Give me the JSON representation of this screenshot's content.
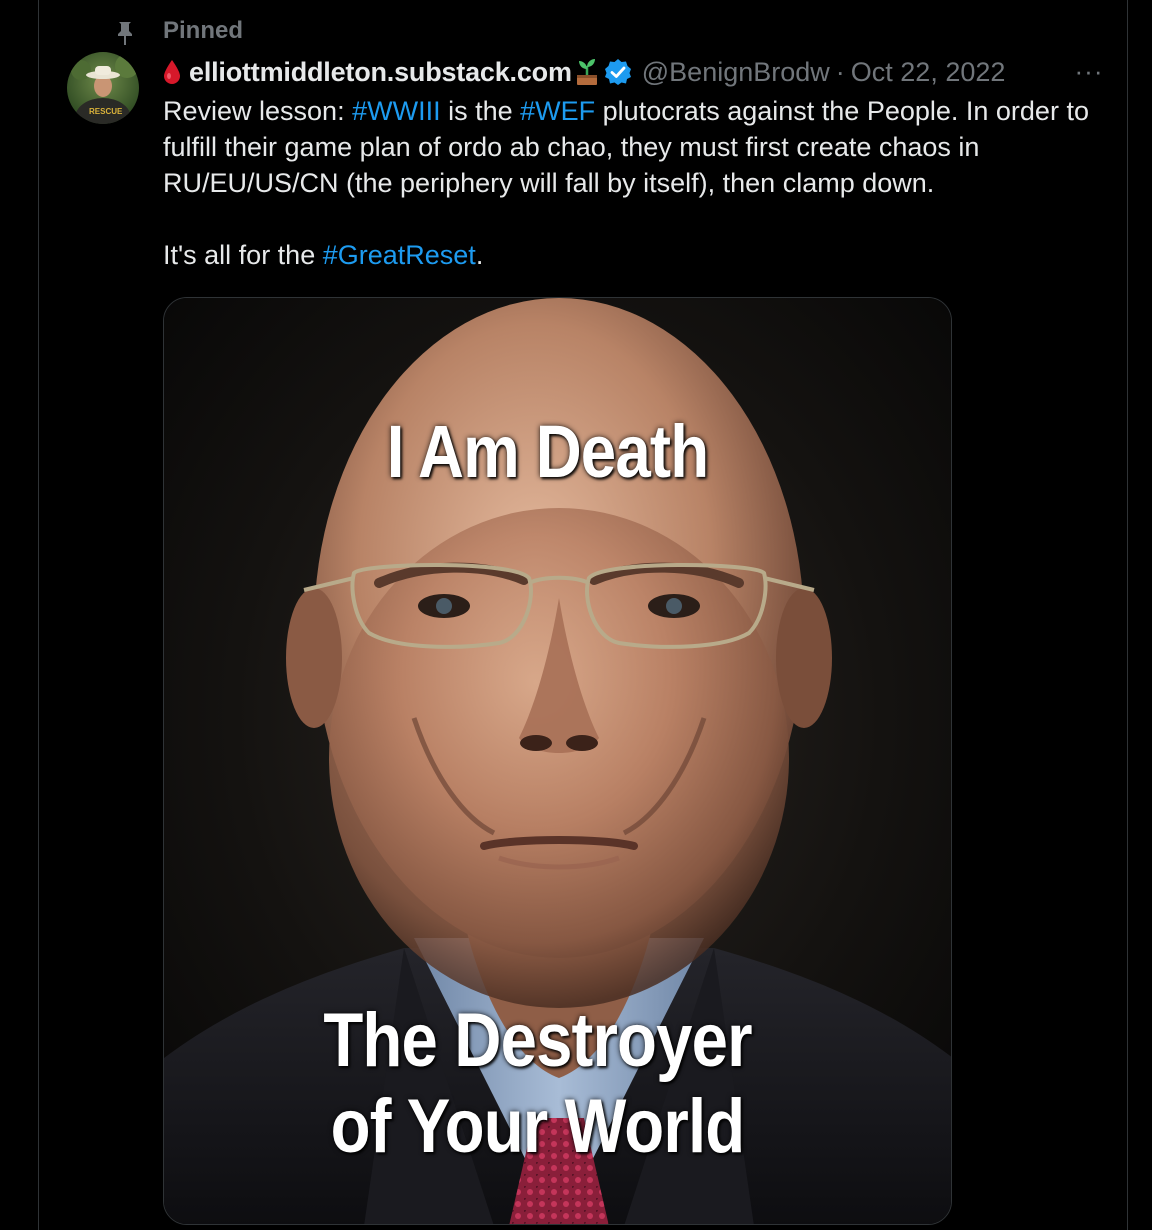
{
  "tweet": {
    "pinned_label": "Pinned",
    "display_name": "elliottmiddleton.substack.com",
    "handle": "@BenignBrodw",
    "separator": "·",
    "date": "Oct 22, 2022",
    "more_label": "···",
    "avatar_badge_text": "RESCUE",
    "text": {
      "line1_prefix": "Review lesson: ",
      "hashtag_wwiii": "#WWIII",
      "line1_mid": " is the ",
      "hashtag_wef": "#WEF",
      "line1_suffix": " plutocrats against the People. In order to fulfill their game plan of ordo ab chao, they must first create chaos in RU/EU/US/CN (the periphery will fall by itself), then clamp down.",
      "line2_prefix": "It's all for the ",
      "hashtag_greatreset": "#GreatReset",
      "line2_suffix": "."
    },
    "media": {
      "caption_top": "I Am Death",
      "caption_bottom_line1": "The Destroyer",
      "caption_bottom_line2": "of Your World"
    }
  },
  "colors": {
    "background": "#000000",
    "text_primary": "#e7e9ea",
    "text_secondary": "#71767b",
    "link": "#1d9bf0",
    "verified": "#1d9bf0",
    "border": "#2f3336"
  },
  "icons": {
    "pin": "pin-icon",
    "drop": "blood-drop-icon",
    "sprout": "sprout-icon",
    "verified": "verified-badge-icon",
    "more": "more-icon"
  }
}
